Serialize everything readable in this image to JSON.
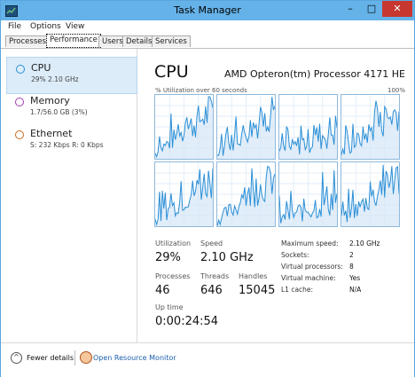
{
  "window": {
    "title": "Task Manager",
    "minimize": "–",
    "maximize": "□",
    "close": "✕"
  },
  "menu": [
    "File",
    "Options",
    "View"
  ],
  "tabs": [
    "Processes",
    "Performance",
    "Users",
    "Details",
    "Services"
  ],
  "active_tab": "Performance",
  "sidebar": [
    {
      "name": "CPU",
      "detail": "29% 2.10 GHz",
      "color": "#2b8fd6",
      "selected": true
    },
    {
      "name": "Memory",
      "detail": "1.7/56.0 GB (3%)",
      "color": "#a23eb3",
      "selected": false
    },
    {
      "name": "Ethernet",
      "detail": "S: 232 Kbps  R: 0 Kbps",
      "color": "#c86b22",
      "selected": false
    }
  ],
  "cpu": {
    "title": "CPU",
    "model": "AMD Opteron(tm) Processor 4171 HE",
    "graph_label": "% Utilization over 60 seconds",
    "graph_max": "100%",
    "cores": 8,
    "graph_color": "#2b8fd6"
  },
  "stats": {
    "utilization_label": "Utilization",
    "utilization": "29%",
    "speed_label": "Speed",
    "speed": "2.10 GHz",
    "processes_label": "Processes",
    "processes": "46",
    "threads_label": "Threads",
    "threads": "646",
    "handles_label": "Handles",
    "handles": "15045",
    "uptime_label": "Up time",
    "uptime": "0:00:24:54"
  },
  "specs": [
    {
      "label": "Maximum speed:",
      "value": "2.10 GHz"
    },
    {
      "label": "Sockets:",
      "value": "2"
    },
    {
      "label": "Virtual processors:",
      "value": "8"
    },
    {
      "label": "Virtual machine:",
      "value": "Yes"
    },
    {
      "label": "L1 cache:",
      "value": "N/A"
    }
  ],
  "footer": {
    "fewer_details": "Fewer details",
    "open_resource_monitor": "Open Resource Monitor"
  }
}
